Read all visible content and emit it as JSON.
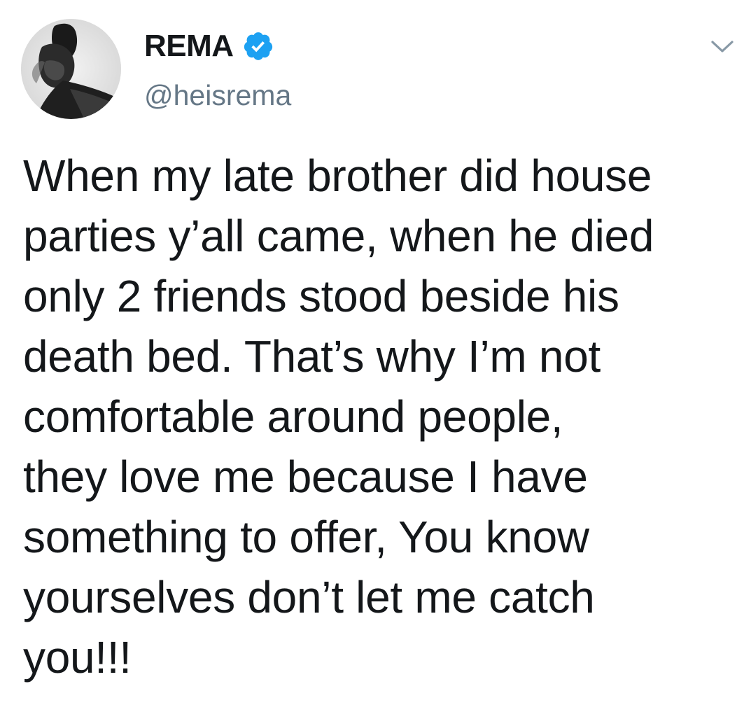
{
  "tweet": {
    "author": {
      "display_name": "REMA",
      "handle": "@heisrema",
      "verified": true,
      "avatar_icon": "profile-photo",
      "verified_color": "#1da1f2"
    },
    "menu_icon": "chevron-down-icon",
    "text_lines": [
      "When my late brother did house",
      "parties y’all came, when he died",
      "only 2 friends stood beside his",
      "death bed. That’s why I’m not",
      "comfortable around people,",
      "they love me because I have",
      "something to offer, You know",
      "yourselves don’t let me catch",
      "you!!!"
    ]
  }
}
